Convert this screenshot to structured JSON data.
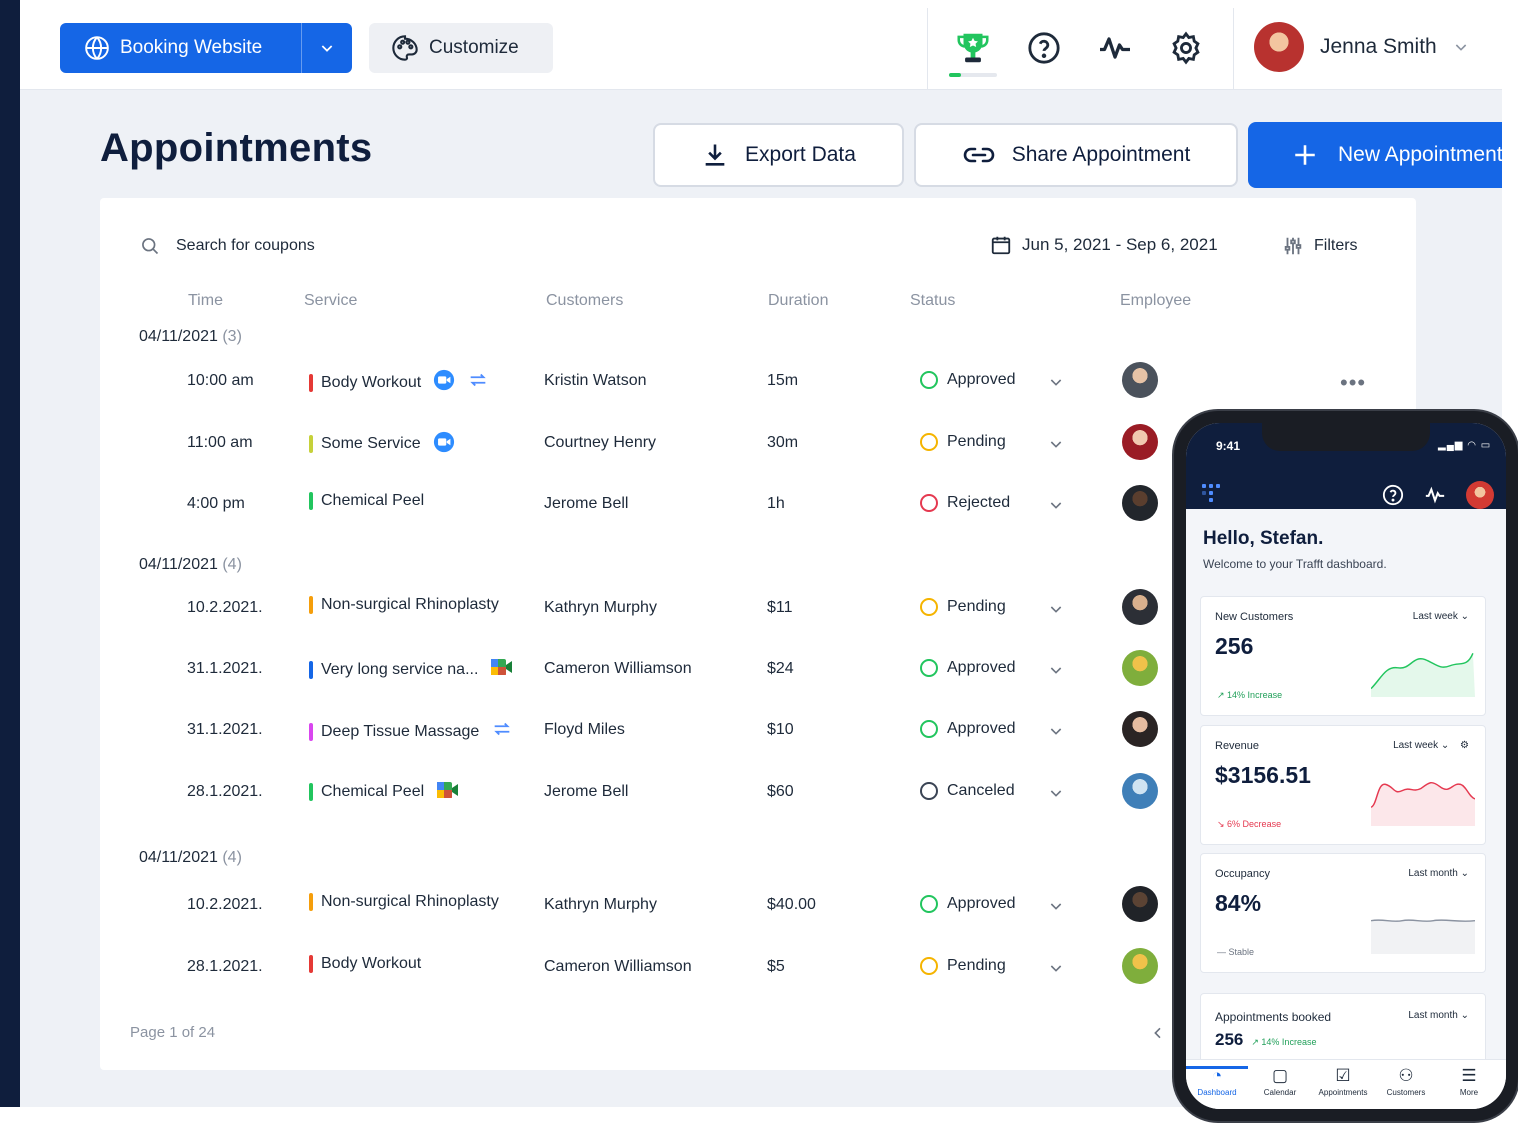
{
  "topbar": {
    "booking_label": "Booking Website",
    "customize_label": "Customize",
    "trophy_progress": 0.25,
    "user_name": "Jenna Smith"
  },
  "header": {
    "title": "Appointments",
    "export_label": "Export Data",
    "share_label": "Share Appointment",
    "new_label": "New Appointment"
  },
  "toolbar": {
    "search_placeholder": "Search for coupons",
    "date_range": "Jun 5, 2021 - Sep 6, 2021",
    "filters_label": "Filters"
  },
  "columns": [
    "Time",
    "Service",
    "Customers",
    "Duration",
    "Status",
    "Employee"
  ],
  "groups": [
    {
      "date": "04/11/2021",
      "count": "(3)",
      "rows": [
        {
          "time": "10:00 am",
          "service": "Body Workout",
          "color": "#e53935",
          "icons": [
            "zoom-icon",
            "recurring-icon"
          ],
          "customer": "Kristin Watson",
          "duration": "15m",
          "status": "Approved"
        },
        {
          "time": "11:00 am",
          "service": "Some Service",
          "color": "#c6d13a",
          "icons": [
            "zoom-icon"
          ],
          "customer": "Courtney Henry",
          "duration": "30m",
          "status": "Pending"
        },
        {
          "time": "4:00 pm",
          "service": "Chemical Peel",
          "color": "#22c55e",
          "icons": [],
          "customer": "Jerome Bell",
          "duration": "1h",
          "status": "Rejected"
        }
      ]
    },
    {
      "date": "04/11/2021",
      "count": "(4)",
      "rows": [
        {
          "time": "10.2.2021.",
          "service": "Non-surgical Rhinoplasty",
          "color": "#f59e0b",
          "icons": [],
          "customer": "Kathryn Murphy",
          "duration": "$11",
          "status": "Pending"
        },
        {
          "time": "31.1.2021.",
          "service": "Very long service na...",
          "color": "#1566e6",
          "icons": [
            "google-meet-icon"
          ],
          "customer": "Cameron Williamson",
          "duration": "$24",
          "status": "Approved"
        },
        {
          "time": "31.1.2021.",
          "service": "Deep Tissue Massage",
          "color": "#d946ef",
          "icons": [
            "recurring-icon"
          ],
          "customer": "Floyd Miles",
          "duration": "$10",
          "status": "Approved"
        },
        {
          "time": "28.1.2021.",
          "service": "Chemical Peel",
          "color": "#22c55e",
          "icons": [
            "google-meet-icon"
          ],
          "customer": "Jerome Bell",
          "duration": "$60",
          "status": "Canceled"
        }
      ]
    },
    {
      "date": "04/11/2021",
      "count": "(4)",
      "rows": [
        {
          "time": "10.2.2021.",
          "service": "Non-surgical Rhinoplasty",
          "color": "#f59e0b",
          "icons": [],
          "customer": "Kathryn Murphy",
          "duration": "$40.00",
          "status": "Approved"
        },
        {
          "time": "28.1.2021.",
          "service": "Body Workout",
          "color": "#e53935",
          "icons": [],
          "customer": "Cameron Williamson",
          "duration": "$5",
          "status": "Pending"
        }
      ]
    }
  ],
  "status_colors": {
    "Approved": "#22c55e",
    "Pending": "#f5b400",
    "Rejected": "#e53950",
    "Canceled": "#3a4454"
  },
  "pager": {
    "text": "Page 1 of 24"
  },
  "phone": {
    "time": "9:41",
    "greeting": "Hello, Stefan.",
    "welcome": "Welcome to your Trafft dashboard.",
    "kpis": [
      {
        "title": "New Customers",
        "period": "Last week",
        "value": "256",
        "delta": "14% Increase",
        "trend": "up"
      },
      {
        "title": "Revenue",
        "period": "Last week",
        "value": "$3156.51",
        "delta": "6% Decrease",
        "trend": "down"
      },
      {
        "title": "Occupancy",
        "period": "Last month",
        "value": "84%",
        "delta": "Stable",
        "trend": "flat"
      }
    ],
    "appointments_card": {
      "title": "Appointments booked",
      "period": "Last month",
      "value": "256",
      "delta": "14% Increase"
    },
    "tabs": [
      "Dashboard",
      "Calendar",
      "Appointments",
      "Customers",
      "More"
    ],
    "active_tab": "Dashboard"
  }
}
